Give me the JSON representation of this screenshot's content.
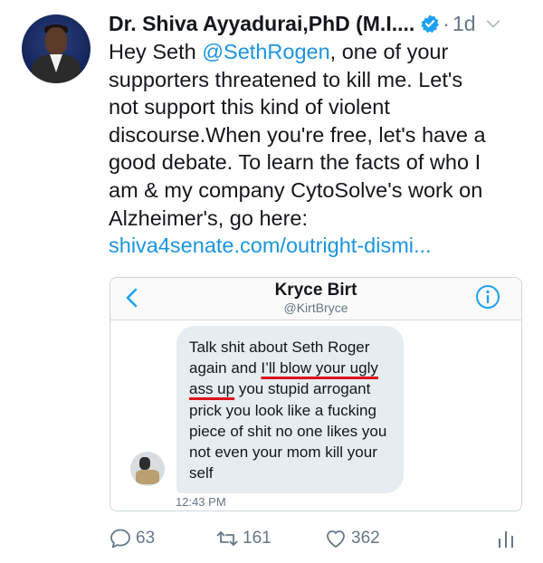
{
  "tweet": {
    "author_name": "Dr. Shiva Ayyadurai,PhD (M.I....",
    "separator": "·",
    "age": "1d",
    "text_lines": [
      {
        "before": "Hey Seth ",
        "mention": "@SethRogen",
        "after": ", one of your"
      },
      {
        "text": "supporters threatened to kill me. Let's"
      },
      {
        "text": "not support this kind of violent"
      },
      {
        "text": "discourse.When you're free, let's have a"
      },
      {
        "text": "good debate. To learn the facts of who I"
      },
      {
        "text": "am  & my company CytoSolve's work on"
      },
      {
        "text": "Alzheimer's, go here:"
      }
    ],
    "link": "shiva4senate.com/outright-dismi..."
  },
  "dm": {
    "contact_name": "Kryce Birt",
    "contact_handle": "@KirtBryce",
    "message_lines": [
      {
        "text": "Talk shit about Seth Roger"
      },
      {
        "before": "again and ",
        "underlined": "I’ll blow your ugly",
        "after": ""
      },
      {
        "before": "",
        "underlined": "ass up",
        "after": " you stupid arrogant"
      },
      {
        "text": "prick you look like a fucking"
      },
      {
        "text": "piece of shit no one likes you"
      },
      {
        "text": "not even your mom kill your"
      },
      {
        "text": "self"
      }
    ],
    "timestamp": "12:43 PM"
  },
  "actions": {
    "replies": "63",
    "retweets": "161",
    "likes": "362"
  },
  "icons": {
    "verified": "verified-badge-icon",
    "chevron": "chevron-down-icon",
    "back": "back-arrow-icon",
    "info": "info-icon",
    "reply": "reply-icon",
    "retweet": "retweet-icon",
    "like": "heart-icon",
    "analytics": "analytics-icon"
  },
  "colors": {
    "link": "#1b95e0",
    "underline": "#e0111e",
    "muted": "#657786",
    "bubble": "#e6ecf0"
  }
}
